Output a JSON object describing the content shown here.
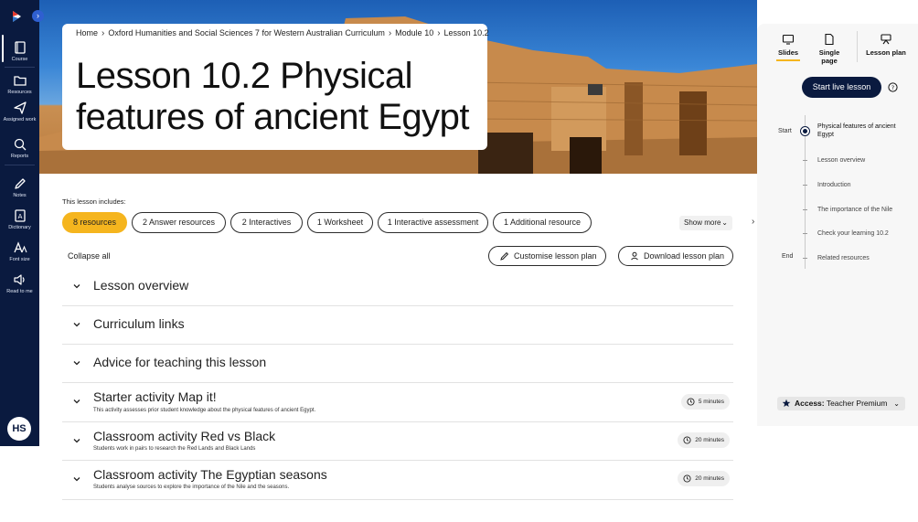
{
  "sidebar": {
    "items": [
      {
        "label": "Course",
        "icon": "book-icon"
      },
      {
        "label": "Resources",
        "icon": "folder-icon"
      },
      {
        "label": "Assigned work",
        "icon": "send-icon"
      },
      {
        "label": "Reports",
        "icon": "reports-icon"
      },
      {
        "label": "Notes",
        "icon": "pencil-icon"
      },
      {
        "label": "Dictionary",
        "icon": "dictionary-icon"
      },
      {
        "label": "Font size",
        "icon": "font-size-icon"
      },
      {
        "label": "Read to me",
        "icon": "speaker-icon"
      }
    ],
    "user_initials": "HS"
  },
  "breadcrumb": {
    "items": [
      "Home",
      "Oxford Humanities and Social Sciences 7 for Western Australian Curriculum",
      "Module 10",
      "Lesson 10.2"
    ]
  },
  "page_title": "Lesson 10.2 Physical features of ancient Egypt",
  "includes": {
    "label": "This lesson includes:",
    "chips": [
      {
        "label": "8 resources",
        "active": true
      },
      {
        "label": "2 Answer resources",
        "active": false
      },
      {
        "label": "2 Interactives",
        "active": false
      },
      {
        "label": "1 Worksheet",
        "active": false
      },
      {
        "label": "1 Interactive assessment",
        "active": false
      },
      {
        "label": "1 Additional resource",
        "active": false
      }
    ],
    "show_more": "Show more"
  },
  "toolbar": {
    "collapse_all": "Collapse all",
    "customise": "Customise lesson plan",
    "download": "Download lesson plan"
  },
  "sections": [
    {
      "title": "Lesson overview"
    },
    {
      "title": "Curriculum links"
    },
    {
      "title": "Advice for teaching this lesson"
    },
    {
      "title": "Starter activity Map it!",
      "subtitle": "This activity assesses prior student knowledge about the physical features of ancient Egypt.",
      "duration": "5 minutes"
    },
    {
      "title": "Classroom activity Red vs Black",
      "subtitle": "Students work in pairs to research the Red Lands and Black Lands",
      "duration": "20 minutes"
    },
    {
      "title": "Classroom activity The Egyptian seasons",
      "subtitle": "Students analyse sources to explore the importance of the Nile and the seasons.",
      "duration": "20 minutes"
    }
  ],
  "right_panel": {
    "tabs": [
      {
        "label": "Slides",
        "active": true,
        "icon": "slides-icon"
      },
      {
        "label": "Single page",
        "active": false,
        "icon": "page-icon"
      },
      {
        "label": "Lesson plan",
        "active": false,
        "icon": "lesson-plan-icon"
      }
    ],
    "start_live": "Start live lesson",
    "timeline": {
      "start_label": "Start",
      "end_label": "End",
      "items": [
        "Physical features of ancient Egypt",
        "Lesson overview",
        "Introduction",
        "The importance of the Nile",
        "Check your learning 10.2",
        "Related resources"
      ]
    },
    "access": {
      "label": "Access:",
      "value": "Teacher Premium"
    }
  },
  "colors": {
    "navy": "#0a1a3f",
    "accent_yellow": "#f5b51e",
    "sky_blue": "#2f74c9",
    "sandstone": "#c98f52"
  }
}
